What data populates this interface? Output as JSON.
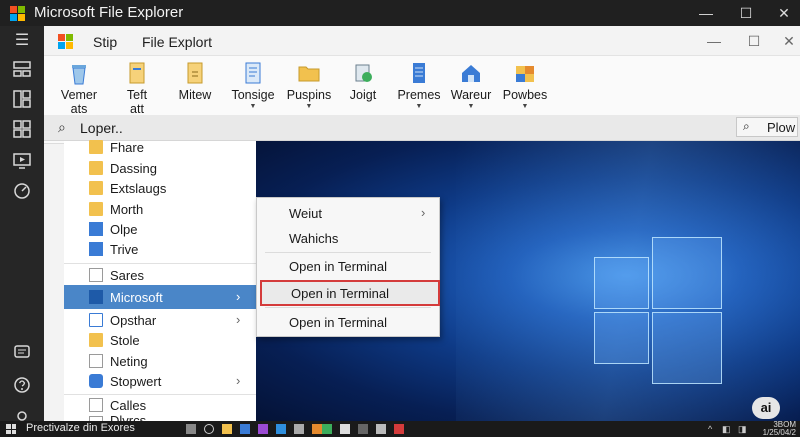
{
  "window": {
    "title": "Microsoft File Explorer",
    "minimize": "—",
    "maximize": "☐",
    "close": "✕"
  },
  "rail": {
    "icons": [
      "menu-icon",
      "grid-icon",
      "layout-icon",
      "apps-icon",
      "monitor-icon",
      "clock-icon",
      "chat-icon",
      "help-icon"
    ]
  },
  "inner": {
    "menu": [
      "Stip",
      "File Explort"
    ],
    "minimize": "—",
    "maximize": "☐",
    "close": "✕"
  },
  "ribbon": {
    "buttons": [
      {
        "label": "Vemer",
        "sub": "ats",
        "dropdown": false
      },
      {
        "label": "Teft",
        "sub": "att",
        "dropdown": false
      },
      {
        "label": "Mitew",
        "sub": "",
        "dropdown": false
      },
      {
        "label": "Tonsige",
        "sub": "",
        "dropdown": true
      },
      {
        "label": "Puspins",
        "sub": "",
        "dropdown": true
      },
      {
        "label": "Joigt",
        "sub": "",
        "dropdown": false
      },
      {
        "label": "Premes",
        "sub": "",
        "dropdown": true
      },
      {
        "label": "Wareur",
        "sub": "",
        "dropdown": true
      },
      {
        "label": "Powbes",
        "sub": "",
        "dropdown": true
      }
    ]
  },
  "search": {
    "text": "Loper..",
    "button_label": "Plow"
  },
  "nav": {
    "items": [
      {
        "label": "Fhare",
        "icon": "folder-icon",
        "chevron": false
      },
      {
        "label": "Dassing",
        "icon": "folder-icon",
        "chevron": false
      },
      {
        "label": "Extslaugs",
        "icon": "folder-icon",
        "chevron": false
      },
      {
        "label": "Morth",
        "icon": "folder-icon",
        "chevron": false
      },
      {
        "label": "Olpe",
        "icon": "drive-icon",
        "chevron": false
      },
      {
        "label": "Trive",
        "icon": "drive-icon",
        "chevron": false
      },
      {
        "label": "Sares",
        "icon": "document-icon",
        "chevron": false
      },
      {
        "label": "Microsoft",
        "icon": "microsoft-icon",
        "chevron": true,
        "selected": true
      },
      {
        "label": "Opsthar",
        "icon": "folder-icon",
        "chevron": true
      },
      {
        "label": "Stole",
        "icon": "folder-icon",
        "chevron": false
      },
      {
        "label": "Neting",
        "icon": "document-icon",
        "chevron": false
      },
      {
        "label": "Stopwert",
        "icon": "network-icon",
        "chevron": true
      },
      {
        "label": "Calles",
        "icon": "document-icon",
        "chevron": false
      },
      {
        "label": "Dlvrcs",
        "icon": "document-icon",
        "chevron": false
      }
    ]
  },
  "context_menu": {
    "items": [
      {
        "label": "Weiut",
        "chevron": true
      },
      {
        "label": "Wahichs",
        "chevron": false
      },
      {
        "label": "Open in Terminal",
        "chevron": false
      },
      {
        "label": "Open in Terminal",
        "chevron": false,
        "highlighted": true
      },
      {
        "label": "Open in Terminal",
        "chevron": false
      }
    ]
  },
  "desktop": {
    "badge": "ai"
  },
  "statusbar": {
    "text": "Prectivalze din Exores",
    "clock_time": "3BOM",
    "clock_date": "1/25/04/2"
  },
  "colors": {
    "accent_selected": "#4a86c8",
    "highlight_border": "#d43b3b",
    "wallpaper": "#0e3a86"
  }
}
